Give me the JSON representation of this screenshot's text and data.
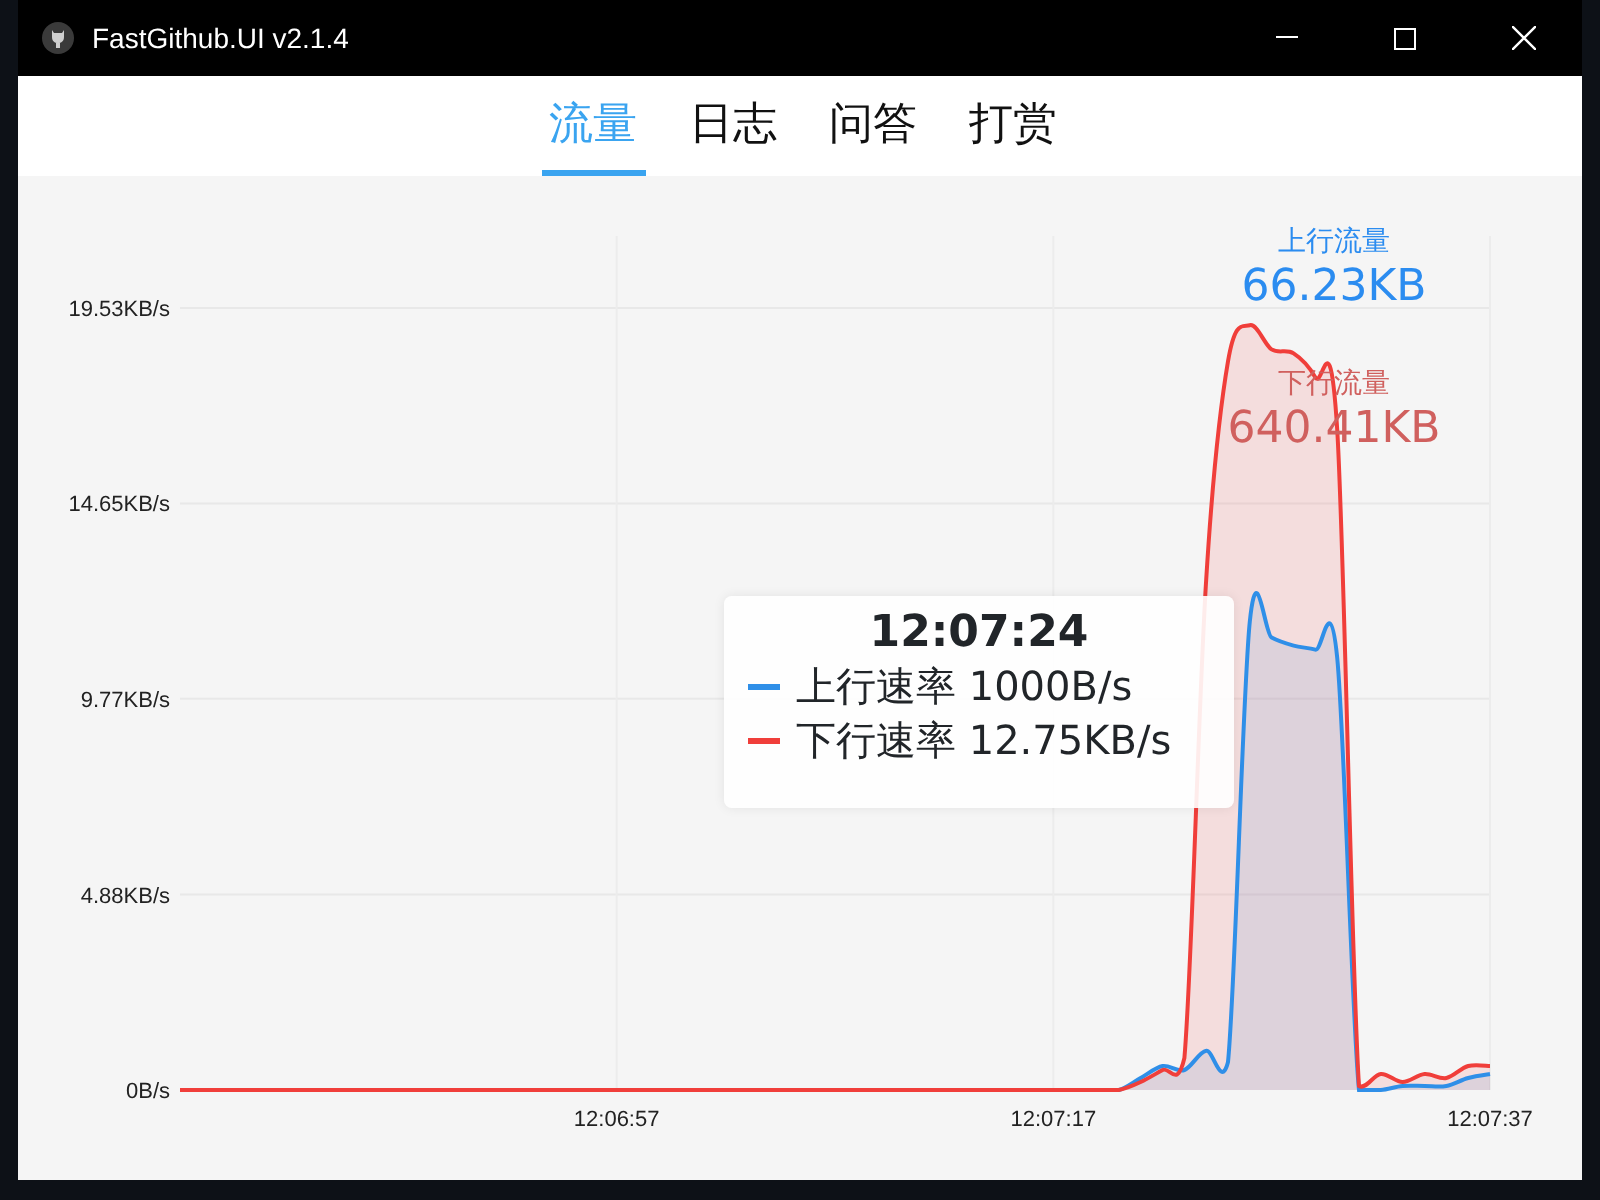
{
  "window": {
    "title": "FastGithub.UI v2.1.4"
  },
  "tabs": [
    {
      "label": "流量",
      "selected": true
    },
    {
      "label": "日志",
      "selected": false
    },
    {
      "label": "问答",
      "selected": false
    },
    {
      "label": "打赏",
      "selected": false
    }
  ],
  "totals": [
    {
      "label": "上行流量",
      "value": "66.23KB",
      "color": "#2b8cf0"
    },
    {
      "label": "下行流量",
      "value": "640.41KB",
      "color": "#d0605e"
    }
  ],
  "tooltip": {
    "time": "12:07:24",
    "rows": [
      {
        "value": "1000B/s"
      },
      {
        "value": "12.75KB/s"
      }
    ]
  },
  "chart_data": {
    "type": "area",
    "grid": true,
    "categories": [
      null,
      null,
      null,
      null,
      null,
      null,
      null,
      null,
      null,
      null,
      null,
      null,
      null,
      null,
      null,
      null,
      null,
      null,
      null,
      null,
      "12:06:57",
      null,
      null,
      null,
      null,
      null,
      null,
      null,
      null,
      null,
      null,
      null,
      null,
      null,
      null,
      null,
      null,
      null,
      null,
      null,
      "12:07:17",
      null,
      null,
      null,
      null,
      null,
      null,
      null,
      null,
      null,
      null,
      null,
      null,
      null,
      null,
      null,
      null,
      null,
      null,
      null,
      "12:07:37"
    ],
    "ylim": [
      0,
      21.33
    ],
    "yticks": [
      {
        "value": 0,
        "label": "0B/s"
      },
      {
        "value": 4.88,
        "label": "4.88KB/s"
      },
      {
        "value": 9.77,
        "label": "9.77KB/s"
      },
      {
        "value": 14.65,
        "label": "14.65KB/s"
      },
      {
        "value": 19.53,
        "label": "19.53KB/s"
      }
    ],
    "series": [
      {
        "name": "上行速率",
        "color": "#2f8fe8",
        "values": [
          0,
          0,
          0,
          0,
          0,
          0,
          0,
          0,
          0,
          0,
          0,
          0,
          0,
          0,
          0,
          0,
          0,
          0,
          0,
          0,
          0,
          0,
          0,
          0,
          0,
          0,
          0,
          0,
          0,
          0,
          0,
          0,
          0,
          0,
          0,
          0,
          0,
          0,
          0,
          0,
          0,
          0,
          0,
          0,
          0.3,
          0.6,
          0.5,
          0.98,
          0.7,
          11.7,
          11.3,
          11.1,
          11.0,
          10.8,
          0,
          0,
          0.1,
          0.1,
          0.1,
          0.3,
          0.4
        ]
      },
      {
        "name": "下行速率",
        "color": "#f03e3a",
        "values": [
          0,
          0,
          0,
          0,
          0,
          0,
          0,
          0,
          0,
          0,
          0,
          0,
          0,
          0,
          0,
          0,
          0,
          0,
          0,
          0,
          0,
          0,
          0,
          0,
          0,
          0,
          0,
          0,
          0,
          0,
          0,
          0,
          0,
          0,
          0,
          0,
          0,
          0,
          0,
          0,
          0,
          0,
          0,
          0,
          0.2,
          0.5,
          0.8,
          12.75,
          18.2,
          19.1,
          18.5,
          18.4,
          17.8,
          16.5,
          0.1,
          0.4,
          0.2,
          0.4,
          0.3,
          0.6,
          0.6
        ]
      }
    ]
  }
}
